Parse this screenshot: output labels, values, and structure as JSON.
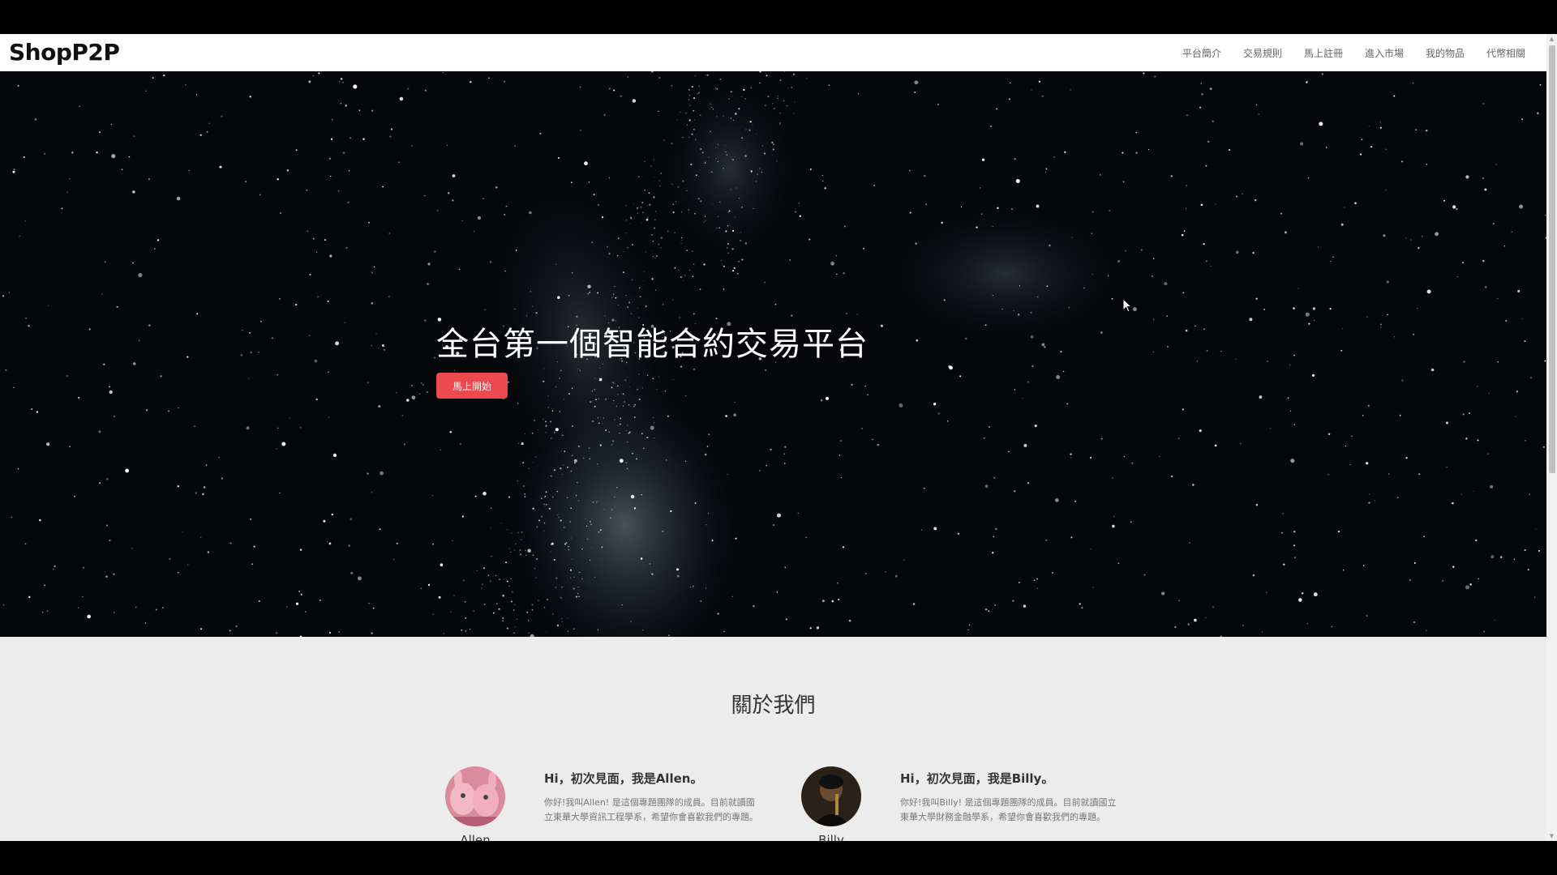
{
  "brand": {
    "logo_text": "ShopP2P"
  },
  "nav": {
    "items": [
      {
        "label": "平台簡介"
      },
      {
        "label": "交易規則"
      },
      {
        "label": "馬上註冊"
      },
      {
        "label": "進入市場"
      },
      {
        "label": "我的物品"
      },
      {
        "label": "代幣相關"
      }
    ]
  },
  "hero": {
    "title": "全台第一個智能合約交易平台",
    "cta_label": "馬上開始"
  },
  "about": {
    "title": "關於我們",
    "members": [
      {
        "name": "Allen",
        "greeting": "Hi，初次見面，我是Allen。",
        "bio": "你好!我叫Allen! 是這個專題團隊的成員。目前就讀國立東華大學資訊工程學系，希望你會喜歡我們的專題。"
      },
      {
        "name": "Billy",
        "greeting": "Hi，初次見面，我是Billy。",
        "bio": "你好!我叫Billy! 是這個專題團隊的成員。目前就讀國立東華大學財務金融學系，希望你會喜歡我們的專題。"
      }
    ]
  },
  "colors": {
    "cta": "#ec4a4f",
    "hero_bg": "#05070b",
    "page_bg": "#ececec"
  },
  "icons": {
    "cursor": "mouse-pointer-icon",
    "scroll_up": "scroll-up-arrow-icon",
    "scroll_down": "scroll-down-arrow-icon"
  }
}
